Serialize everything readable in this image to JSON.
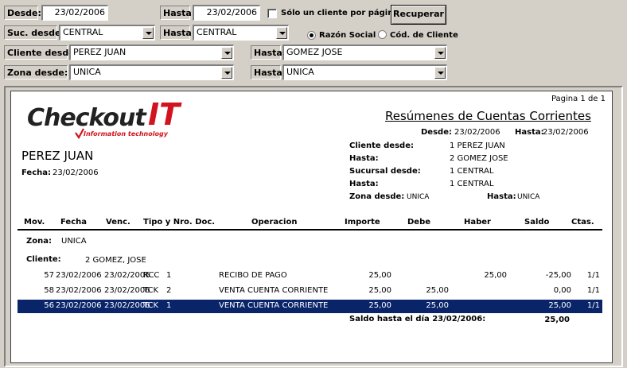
{
  "filters": {
    "desde_label": "Desde:",
    "desde_value": "23/02/2006",
    "hasta_label": "Hasta:",
    "hasta_value": "23/02/2006",
    "solo_un_cliente_label": "Sólo un cliente por página?",
    "solo_un_cliente_checked": false,
    "recuperar_label": "Recuperar",
    "suc_desde_label": "Suc. desde:",
    "suc_desde_value": "CENTRAL",
    "suc_hasta_label": "Hasta:",
    "suc_hasta_value": "CENTRAL",
    "razon_social_label": "Razón Social",
    "cod_cliente_label": "Cód. de Cliente",
    "order_by_selected": "Razón Social",
    "cliente_desde_label": "Cliente desde:",
    "cliente_desde_value": "PEREZ JUAN",
    "cliente_hasta_label": "Hasta:",
    "cliente_hasta_value": "GOMEZ JOSE",
    "zona_desde_label": "Zona desde:",
    "zona_desde_value": "UNICA",
    "zona_hasta_label": "Hasta:",
    "zona_hasta_value": "UNICA"
  },
  "report": {
    "page_info": "Pagina 1 de 1",
    "logo_text_main": "Checkout",
    "logo_text_it": "IT",
    "logo_tagline": "Information technology",
    "title": "Resúmenes de Cuentas Corrientes",
    "desde_label": "Desde:",
    "desde_value": "23/02/2006",
    "hasta_label": "Hasta:",
    "hasta_value": "23/02/2006",
    "user_name": "PEREZ JUAN",
    "fecha_label": "Fecha:",
    "fecha_value": "23/02/2006",
    "params": {
      "cliente_desde_label": "Cliente desde:",
      "cliente_desde_value": "1 PEREZ JUAN",
      "cliente_hasta_label": "Hasta:",
      "cliente_hasta_value": "2 GOMEZ JOSE",
      "sucursal_desde_label": "Sucursal desde:",
      "sucursal_desde_value": "1 CENTRAL",
      "sucursal_hasta_label": "Hasta:",
      "sucursal_hasta_value": "1 CENTRAL",
      "zona_desde_label": "Zona desde:",
      "zona_desde_value": "UNICA",
      "zona_hasta_label": "Hasta:",
      "zona_hasta_value": "UNICA"
    },
    "columns": [
      "Mov.",
      "Fecha",
      "Venc.",
      "Tipo y Nro. Doc.",
      "Operacion",
      "Importe",
      "Debe",
      "Haber",
      "Saldo",
      "Ctas."
    ],
    "zona_label": "Zona:",
    "zona_value": "UNICA",
    "cliente_label": "Cliente:",
    "cliente_value": "2 GOMEZ, JOSE",
    "rows": [
      {
        "mov": "57",
        "fecha": "23/02/2006",
        "venc": "23/02/2006",
        "tipo": "RCC",
        "nro": "1",
        "operacion": "RECIBO DE PAGO",
        "importe": "25,00",
        "debe": "",
        "haber": "25,00",
        "saldo": "-25,00",
        "ctas": "1/1"
      },
      {
        "mov": "58",
        "fecha": "23/02/2006",
        "venc": "23/02/2006",
        "tipo": "TCK",
        "nro": "2",
        "operacion": "VENTA CUENTA CORRIENTE",
        "importe": "25,00",
        "debe": "25,00",
        "haber": "",
        "saldo": "0,00",
        "ctas": "1/1"
      },
      {
        "mov": "56",
        "fecha": "23/02/2006",
        "venc": "23/02/2006",
        "tipo": "TCK",
        "nro": "1",
        "operacion": "VENTA CUENTA CORRIENTE",
        "importe": "25,00",
        "debe": "25,00",
        "haber": "",
        "saldo": "25,00",
        "ctas": "1/1"
      }
    ],
    "selected_row": 2,
    "saldo_label": "Saldo hasta el día 23/02/2006:",
    "saldo_value": "25,00"
  },
  "colors": {
    "selection": "#0a246a",
    "logo_red": "#d2141e",
    "logo_dark": "#222222"
  }
}
